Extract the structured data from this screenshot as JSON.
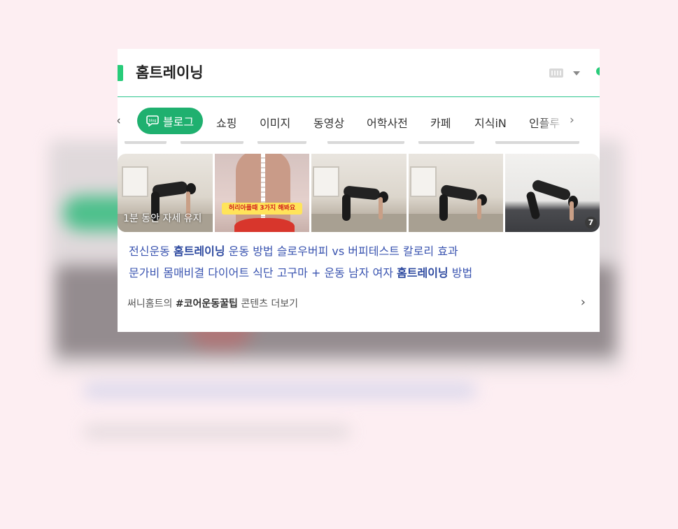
{
  "search": {
    "query": "홈트레이닝"
  },
  "tabs": {
    "active": "블로그",
    "items": [
      "쇼핑",
      "이미지",
      "동영상",
      "어학사전",
      "카페",
      "지식iN",
      "인플루"
    ],
    "prev_glyph": "‹",
    "next_glyph": "›"
  },
  "thumbnails": {
    "first_caption": "1분 동안 자세 유지",
    "banner_text": "허리아플때 3가지 해봐요",
    "count_badge": "7"
  },
  "related_links": [
    {
      "pre": "전신운동 ",
      "bold": "홈트레이닝",
      "post": " 운동 방법 슬로우버피 vs 버피테스트 칼로리 효과"
    },
    {
      "pre": "문가비 몸매비결 다이어트 식단 고구마 + 운동 남자 여자 ",
      "bold": "홈트레이닝",
      "post": " 방법"
    }
  ],
  "more": {
    "author": "써니홈트의 ",
    "tag": "#코어운동꿀팁",
    "suffix": " 콘텐츠 더보기",
    "chevron": "›"
  },
  "colors": {
    "accent": "#1fb06f",
    "link": "#3a54b0",
    "background": "#fdeef2"
  }
}
